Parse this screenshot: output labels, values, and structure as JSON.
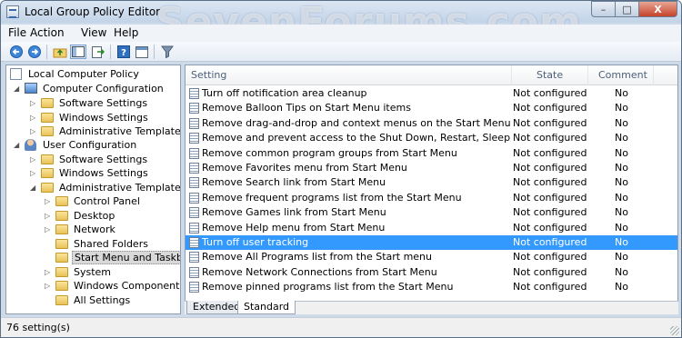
{
  "window": {
    "title": "Local Group Policy Editor",
    "watermark": "SevenForums.com",
    "min_glyph": "–",
    "max_glyph": "□",
    "close_glyph": "X"
  },
  "menu": [
    "File",
    "Action",
    "View",
    "Help"
  ],
  "toolbar": {
    "icons": [
      "back-arrow-icon",
      "forward-arrow-icon",
      "up-folder-icon",
      "show-hide-tree-icon",
      "export-list-icon",
      "help-icon",
      "properties-icon",
      "filter-icon"
    ]
  },
  "tree": {
    "items": [
      {
        "label": "Local Computer Policy",
        "level": 0,
        "icon": "doc-icon",
        "expander": ""
      },
      {
        "label": "Computer Configuration",
        "level": 1,
        "icon": "computer-icon",
        "expander": "◢"
      },
      {
        "label": "Software Settings",
        "level": 2,
        "icon": "folder-icon",
        "expander": "▷"
      },
      {
        "label": "Windows Settings",
        "level": 2,
        "icon": "folder-icon",
        "expander": "▷"
      },
      {
        "label": "Administrative Templates",
        "level": 2,
        "icon": "folder-icon",
        "expander": "▷"
      },
      {
        "label": "User Configuration",
        "level": 1,
        "icon": "user-icon",
        "expander": "◢"
      },
      {
        "label": "Software Settings",
        "level": 2,
        "icon": "folder-icon",
        "expander": "▷"
      },
      {
        "label": "Windows Settings",
        "level": 2,
        "icon": "folder-icon",
        "expander": "▷"
      },
      {
        "label": "Administrative Templates",
        "level": 2,
        "icon": "folder-icon",
        "expander": "◢"
      },
      {
        "label": "Control Panel",
        "level": 3,
        "icon": "folder-icon",
        "expander": "▷"
      },
      {
        "label": "Desktop",
        "level": 3,
        "icon": "folder-icon",
        "expander": "▷"
      },
      {
        "label": "Network",
        "level": 3,
        "icon": "folder-icon",
        "expander": "▷"
      },
      {
        "label": "Shared Folders",
        "level": 3,
        "icon": "folder-icon",
        "expander": ""
      },
      {
        "label": "Start Menu and Taskbar",
        "level": 3,
        "icon": "folder-icon",
        "expander": "",
        "selected": true
      },
      {
        "label": "System",
        "level": 3,
        "icon": "folder-icon",
        "expander": "▷"
      },
      {
        "label": "Windows Components",
        "level": 3,
        "icon": "folder-icon",
        "expander": "▷"
      },
      {
        "label": "All Settings",
        "level": 3,
        "icon": "folder-icon",
        "expander": ""
      }
    ]
  },
  "list": {
    "columns": {
      "setting": "Setting",
      "state": "State",
      "comment": "Comment"
    },
    "rows": [
      {
        "setting": "Turn off notification area cleanup",
        "state": "Not configured",
        "comment": "No"
      },
      {
        "setting": "Remove Balloon Tips on Start Menu items",
        "state": "Not configured",
        "comment": "No"
      },
      {
        "setting": "Remove drag-and-drop and context menus on the Start Menu",
        "state": "Not configured",
        "comment": "No"
      },
      {
        "setting": "Remove and prevent access to the Shut Down, Restart, Sleep, and Hiber...",
        "state": "Not configured",
        "comment": "No"
      },
      {
        "setting": "Remove common program groups from Start Menu",
        "state": "Not configured",
        "comment": "No"
      },
      {
        "setting": "Remove Favorites menu from Start Menu",
        "state": "Not configured",
        "comment": "No"
      },
      {
        "setting": "Remove Search link from Start Menu",
        "state": "Not configured",
        "comment": "No"
      },
      {
        "setting": "Remove frequent programs list from the Start Menu",
        "state": "Not configured",
        "comment": "No"
      },
      {
        "setting": "Remove Games link from Start Menu",
        "state": "Not configured",
        "comment": "No"
      },
      {
        "setting": "Remove Help menu from Start Menu",
        "state": "Not configured",
        "comment": "No"
      },
      {
        "setting": "Turn off user tracking",
        "state": "Not configured",
        "comment": "No",
        "selected": true
      },
      {
        "setting": "Remove All Programs list from the Start menu",
        "state": "Not configured",
        "comment": "No"
      },
      {
        "setting": "Remove Network Connections from Start Menu",
        "state": "Not configured",
        "comment": "No"
      },
      {
        "setting": "Remove pinned programs list from the Start Menu",
        "state": "Not configured",
        "comment": "No"
      }
    ]
  },
  "tabs": [
    "Extended",
    "Standard"
  ],
  "active_tab": "Standard",
  "status": "76 setting(s)",
  "colors": {
    "selection": "#3399ff",
    "frame": "#ccdaea"
  }
}
